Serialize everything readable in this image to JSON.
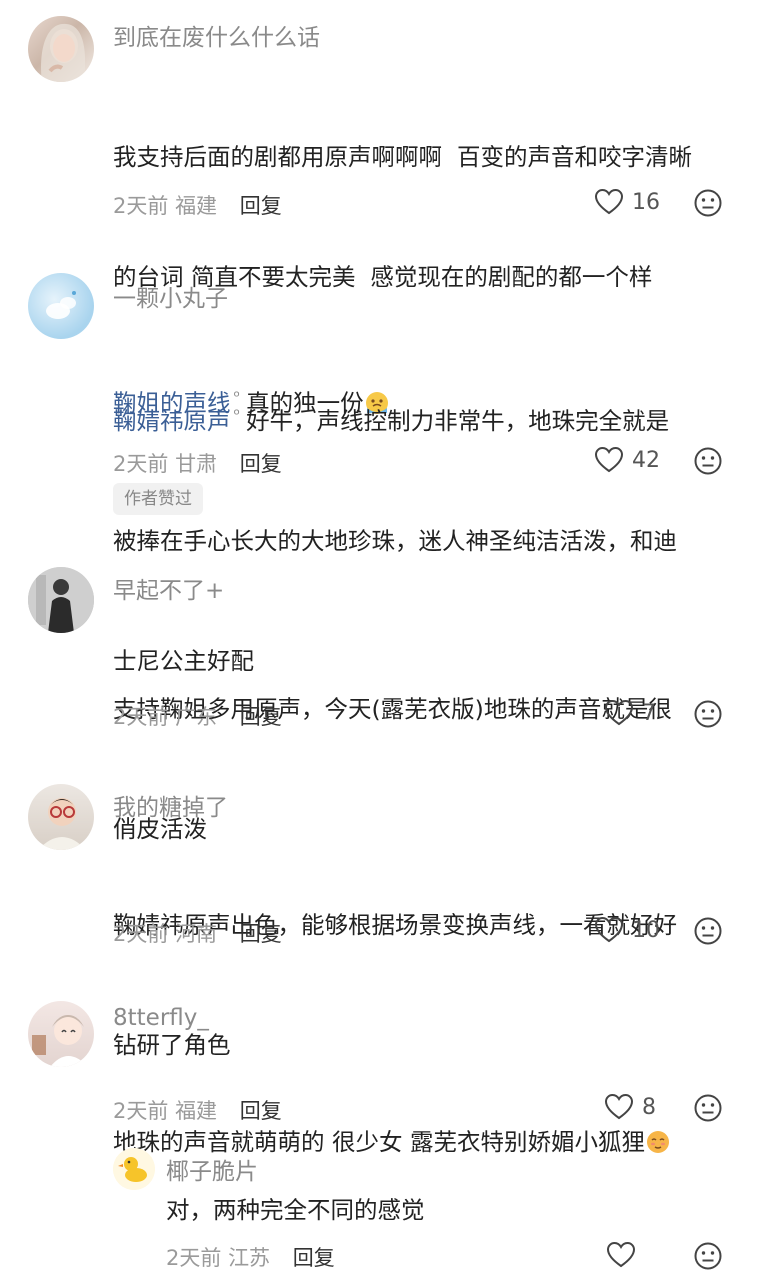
{
  "comments": [
    {
      "username": "到底在废什么什么话",
      "text_line1": "我支持后面的剧都用原声啊啊啊  百变的声音和咬字清晰",
      "text_line2": "的台词 简直不要太完美  感觉现在的剧配的都一个样",
      "mention": "鞠姐的声线",
      "text_after_mention": "真的独一份",
      "time": "2天前",
      "location": "福建",
      "reply_label": "回复",
      "likes": "16"
    },
    {
      "username": "一颗小丸子",
      "mention": "鞠婧祎原声",
      "text_line1": "好牛，声线控制力非常牛，地珠完全就是",
      "text_line2": "被捧在手心长大的大地珍珠，迷人神圣纯洁活泼，和迪",
      "text_line3": "士尼公主好配",
      "time": "2天前",
      "location": "甘肃",
      "reply_label": "回复",
      "likes": "42",
      "badge": "作者赞过"
    },
    {
      "username": "早起不了+",
      "text_line1": "支持鞠姐多用原声，今天(露芜衣版)地珠的声音就是很",
      "text_line2": "俏皮活泼",
      "time": "2天前",
      "location": "广东",
      "reply_label": "回复",
      "likes": "7"
    },
    {
      "username": "我的糖掉了",
      "text_line1": "鞠婧祎原声出色，能够根据场景变换声线，一看就好好",
      "text_line2": "钻研了角色",
      "time": "2天前",
      "location": "河南",
      "reply_label": "回复",
      "likes": "10"
    },
    {
      "username": "8tterfly_",
      "text_line1": "地珠的声音就萌萌的 很少女 露芜衣特别娇媚小狐狸",
      "time": "2天前",
      "location": "福建",
      "reply_label": "回复",
      "likes": "8"
    }
  ],
  "sub_reply": {
    "username": "椰子脆片",
    "text": "对，两种完全不同的感觉",
    "time": "2天前",
    "location": "江苏",
    "reply_label": "回复"
  },
  "icons": {
    "like": "heart-outline-icon",
    "dislike": "meh-face-icon",
    "search": "search-mark-icon"
  }
}
